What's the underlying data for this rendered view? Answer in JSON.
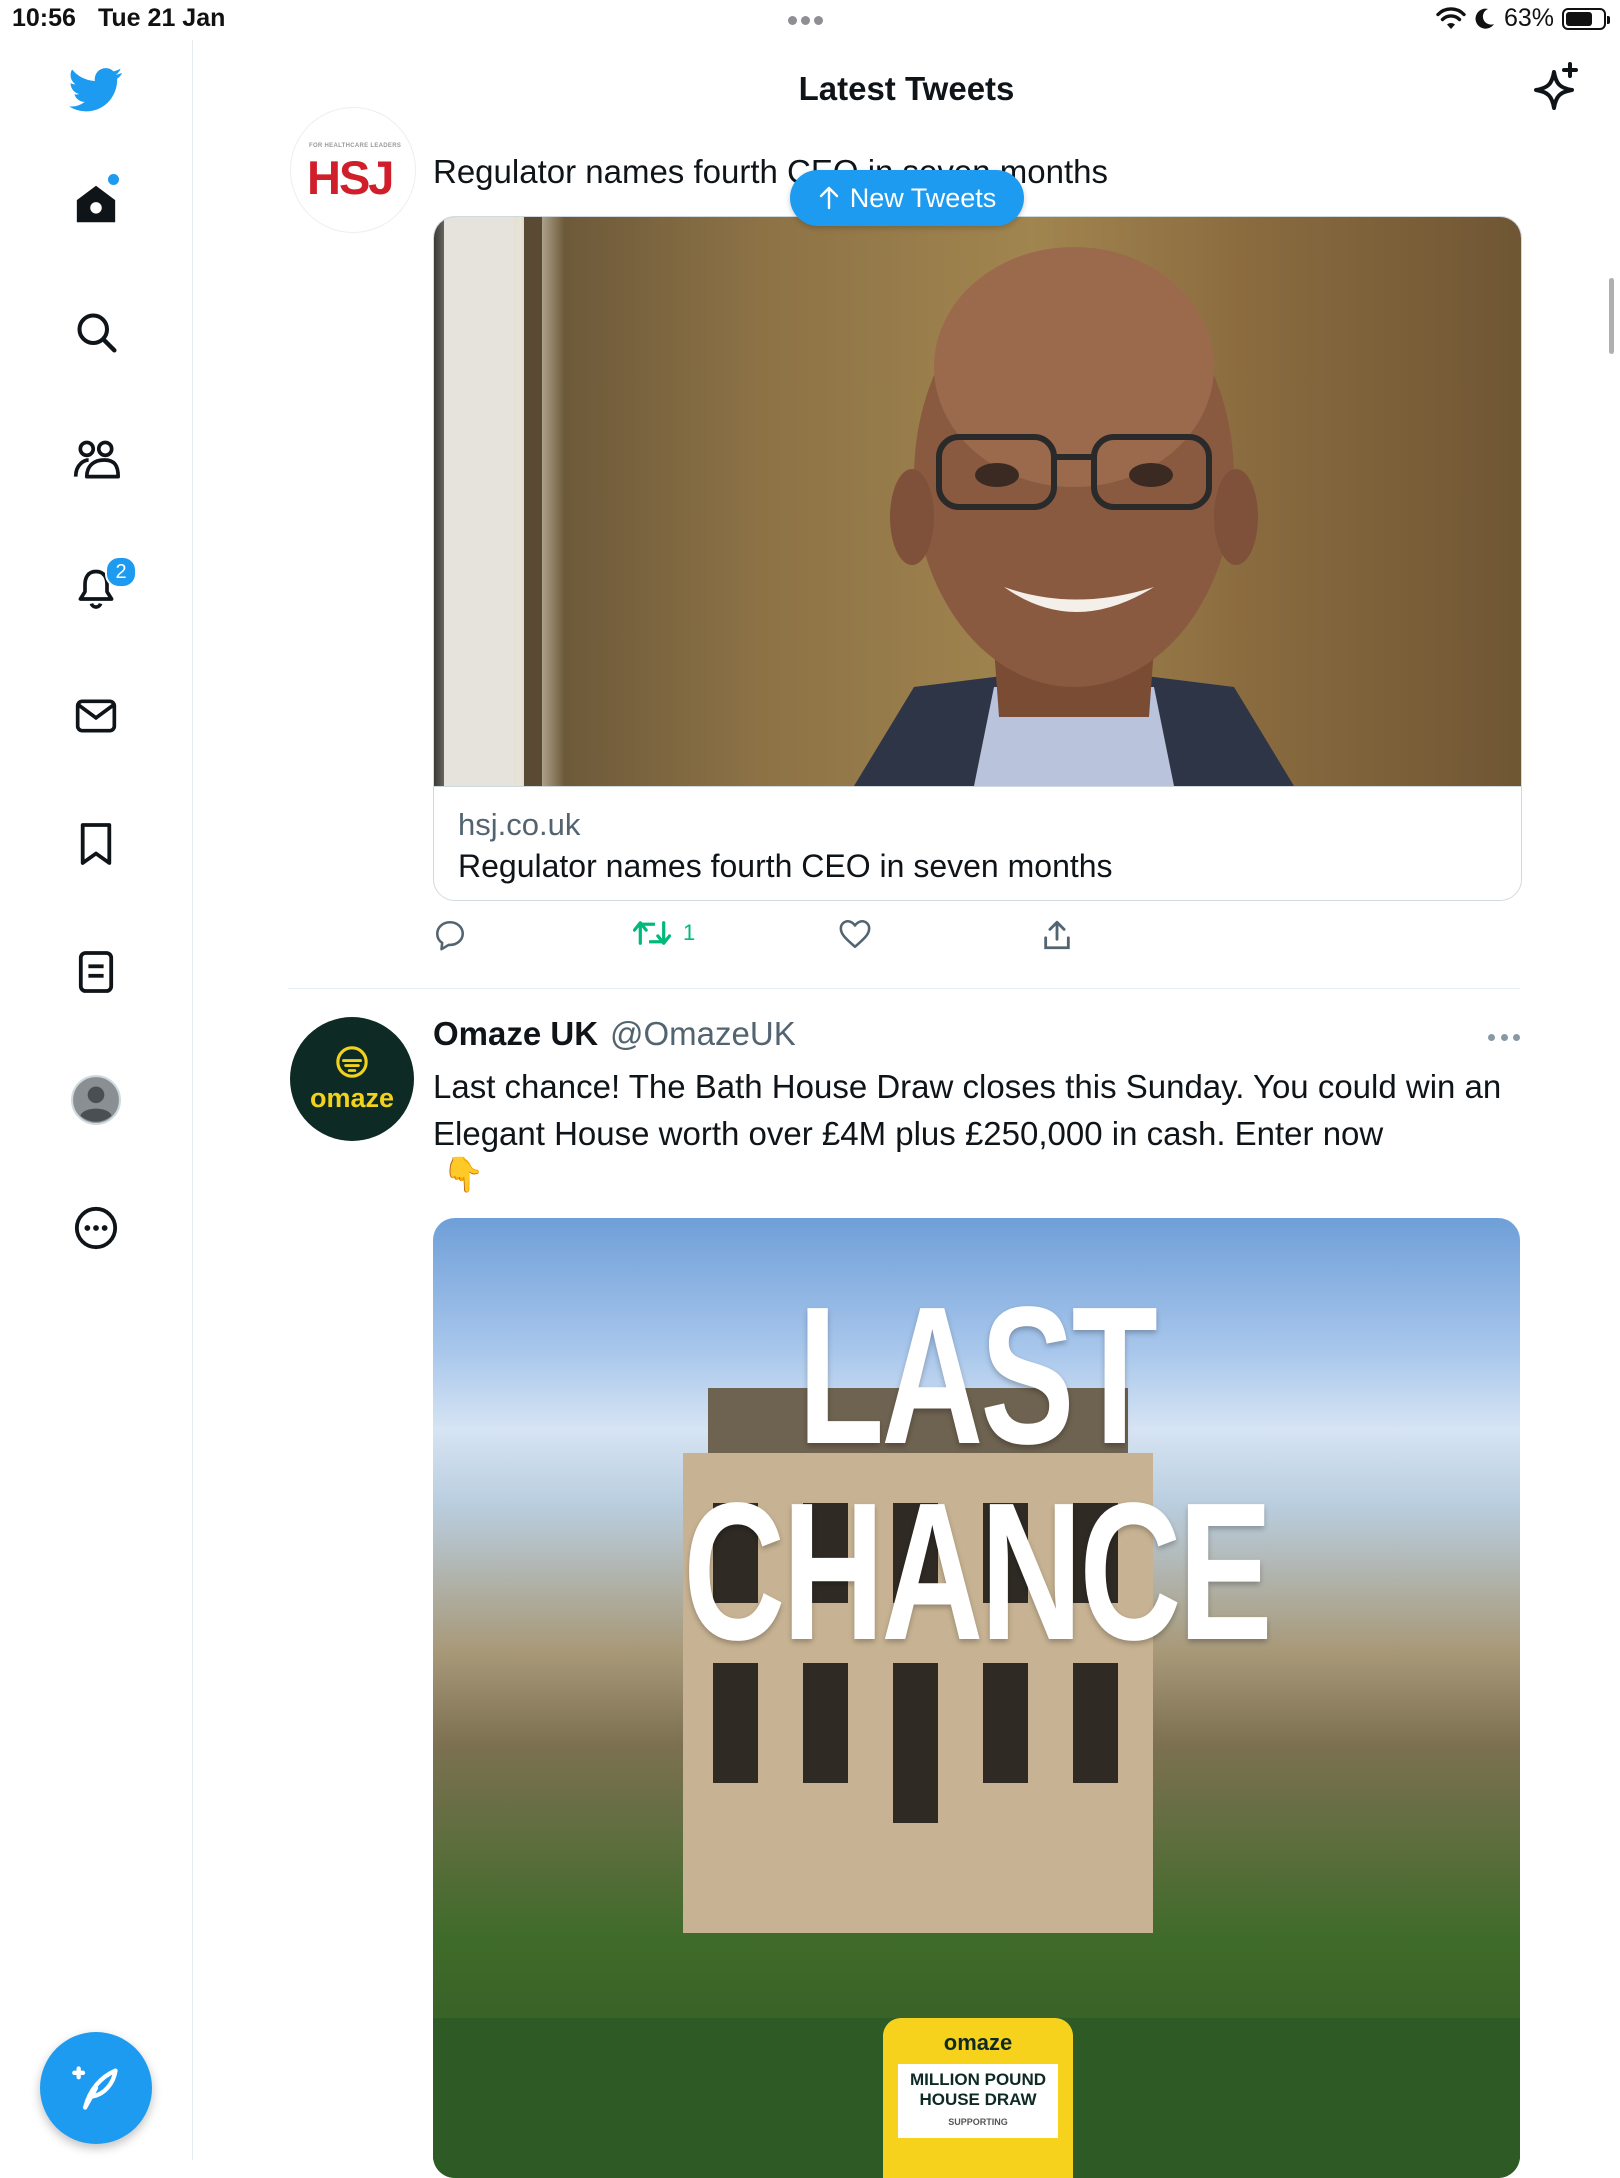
{
  "status_bar": {
    "time": "10:56",
    "date": "Tue 21 Jan",
    "battery": "63%",
    "battery_level": 0.63
  },
  "header": {
    "title": "Latest Tweets"
  },
  "sidebar": {
    "notifications_badge": "2",
    "items": [
      "twitter-logo",
      "home-icon",
      "search-icon",
      "communities-icon",
      "notifications-icon",
      "messages-icon",
      "bookmarks-icon",
      "lists-icon",
      "profile-avatar",
      "more-icon"
    ]
  },
  "new_tweets_button": {
    "label": "New Tweets"
  },
  "tweet1": {
    "avatar_small_text": "FOR HEALTHCARE LEADERS",
    "avatar_text": "HSJ",
    "text": "Regulator names fourth CEO in seven months",
    "card": {
      "domain": "hsj.co.uk",
      "title": "Regulator names fourth CEO in seven months"
    },
    "retweet_count": "1"
  },
  "tweet2": {
    "name": "Omaze UK",
    "handle": "@OmazeUK",
    "avatar_text": "omaze",
    "text": "Last chance! The Bath House Draw closes this Sunday. You could win an Elegant House worth over £4M plus £250,000 in cash. Enter now",
    "emoji": "👇",
    "image": {
      "headline": "LAST CHANCE",
      "badge_brand": "omaze",
      "badge_line1": "MILLION POUND",
      "badge_line2": "HOUSE DRAW",
      "badge_supporting": "SUPPORTING"
    }
  },
  "colors": {
    "accent": "#1d9bf0",
    "retweet": "#00ba7c",
    "omaze_yellow": "#f2d21b",
    "hsj_red": "#d01f2a"
  }
}
